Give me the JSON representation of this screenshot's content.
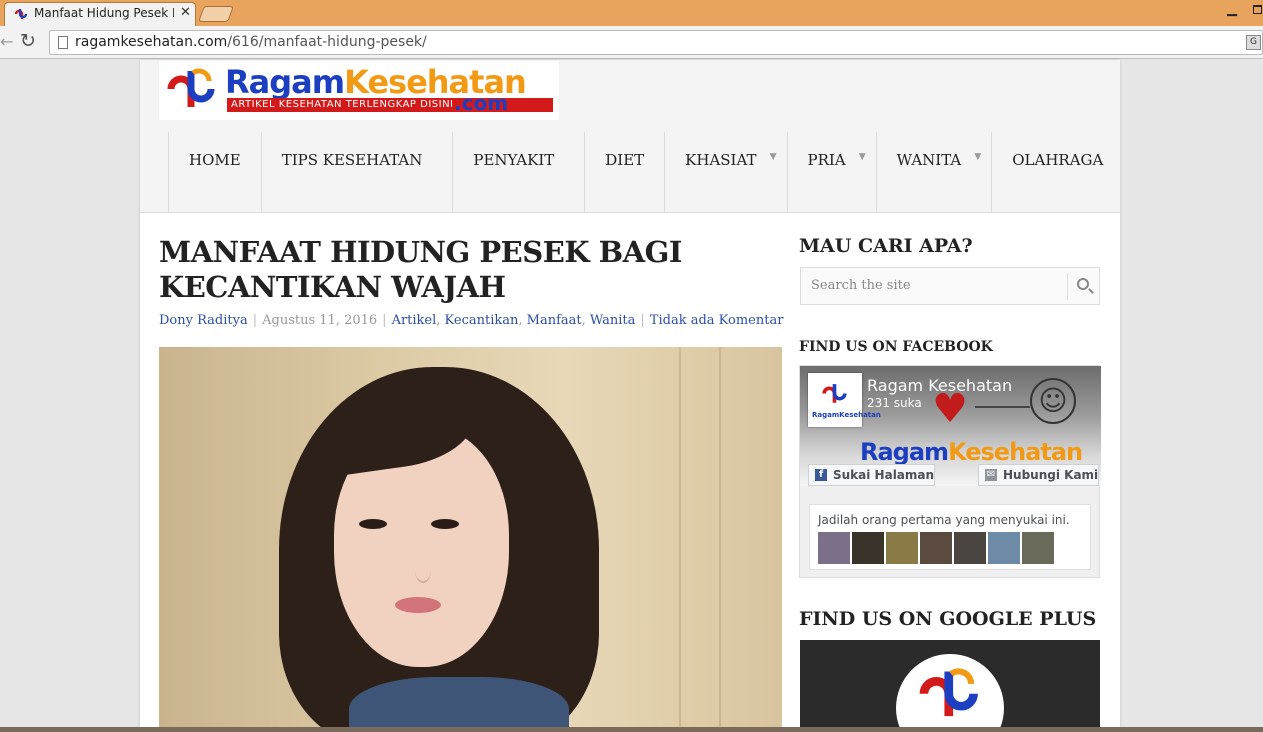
{
  "browser": {
    "tab_title": "Manfaat Hidung Pesek Ba",
    "tab_close": "✕",
    "url_host": "ragamkesehatan.com",
    "url_path": "/616/manfaat-hidung-pesek/",
    "back_icon": "←",
    "reload_icon": "↻",
    "minimize_icon": "▁"
  },
  "site": {
    "logo_part1": "Ragam",
    "logo_part2": "Kesehatan",
    "logo_tagline": "ARTIKEL KESEHATAN TERLENGKAP DISINI",
    "logo_suffix": ".com"
  },
  "nav": {
    "items": [
      {
        "label": "HOME",
        "has_submenu": false
      },
      {
        "label": "TIPS KESEHATAN",
        "has_submenu": false
      },
      {
        "label": "PENYAKIT",
        "has_submenu": false
      },
      {
        "label": "DIET",
        "has_submenu": false
      },
      {
        "label": "KHASIAT",
        "has_submenu": true
      },
      {
        "label": "PRIA",
        "has_submenu": true
      },
      {
        "label": "WANITA",
        "has_submenu": true
      },
      {
        "label": "OLAHRAGA",
        "has_submenu": false
      }
    ],
    "caret": "▼"
  },
  "post": {
    "title": "MANFAAT HIDUNG PESEK BAGI KECANTIKAN WAJAH",
    "author": "Dony Raditya",
    "date": "Agustus 11, 2016",
    "categories": [
      "Artikel",
      "Kecantikan",
      "Manfaat",
      "Wanita"
    ],
    "comments": "Tidak ada Komentar",
    "separator": "|"
  },
  "sidebar": {
    "search_heading": "MAU CARI APA?",
    "search_placeholder": "Search the site",
    "facebook_heading": "FIND US ON FACEBOOK",
    "facebook": {
      "page_name": "Ragam Kesehatan",
      "likes": "231 suka",
      "like_button": "Sukai Halaman",
      "contact_button": "Hubungi Kami",
      "friends_text": "Jadilah orang pertama yang menyukai ini.",
      "thumb_label": "RagamKesehatan"
    },
    "gplus_heading": "FIND US ON GOOGLE PLUS"
  },
  "colors": {
    "chrome_frame": "#e8a35c",
    "brand_blue": "#1c3fc1",
    "brand_orange": "#f39a15",
    "brand_red": "#d21a1a",
    "link_blue": "#2a4fa8"
  }
}
